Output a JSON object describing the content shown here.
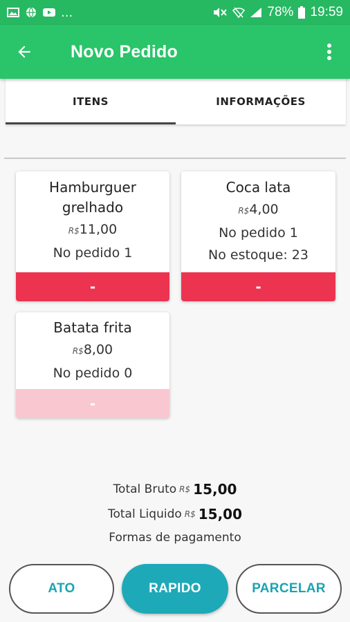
{
  "status_bar": {
    "left_icons": [
      "image-icon",
      "globe-icon",
      "youtube-icon"
    ],
    "overflow": "...",
    "battery": "78%",
    "time": "19:59"
  },
  "app_bar": {
    "title": "Novo Pedido"
  },
  "tabs": [
    {
      "label": "ITENS",
      "active": true
    },
    {
      "label": "INFORMAÇÕES",
      "active": false
    }
  ],
  "products": [
    {
      "name": "Hamburguer grelhado",
      "currency": "R$",
      "price": "11,00",
      "ordered_label": "No pedido",
      "ordered_count": "1",
      "button": "-"
    },
    {
      "name": "Coca lata",
      "currency": "R$",
      "price": "4,00",
      "ordered_label": "No pedido",
      "ordered_count": "1",
      "stock_label": "No estoque:",
      "stock_count": "23",
      "button": "-"
    },
    {
      "name": "Batata frita",
      "currency": "R$",
      "price": "8,00",
      "ordered_label": "No pedido",
      "ordered_count": "0",
      "button": "-"
    }
  ],
  "totals": {
    "gross_label": "Total Bruto",
    "gross_currency": "R$",
    "gross_value": "15,00",
    "net_label": "Total Liquido",
    "net_currency": "R$",
    "net_value": "15,00",
    "payment_label": "Formas de pagamento"
  },
  "payment_buttons": {
    "ato": "ATO",
    "rapido": "RAPIDO",
    "parcelar": "PARCELAR"
  },
  "colors": {
    "status_bar": "#27b862",
    "app_bar": "#2ac46a",
    "minus_active": "#ec3450",
    "minus_disabled": "#f9c7d0",
    "accent": "#1da9b8"
  }
}
